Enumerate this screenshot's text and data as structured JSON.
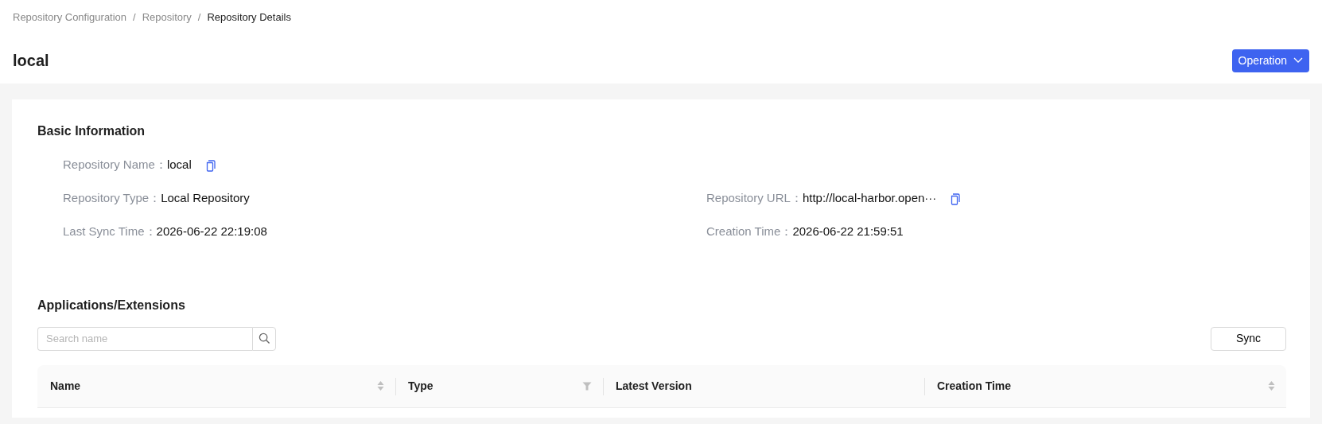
{
  "breadcrumb": [
    {
      "label": "Repository Configuration",
      "current": false
    },
    {
      "label": "Repository",
      "current": false
    },
    {
      "label": "Repository Details",
      "current": true
    }
  ],
  "breadcrumb_separator": "/",
  "page_title": "local",
  "operation_button": {
    "label": "Operation"
  },
  "basic_information": {
    "title": "Basic Information",
    "rows": [
      [
        {
          "label": "Repository Name：",
          "value": "local",
          "copyable": true
        }
      ],
      [
        {
          "label": "Repository Type：",
          "value": "Local Repository",
          "copyable": false
        },
        {
          "label": "Repository URL：",
          "value": "http://local-harbor.open···",
          "copyable": true
        }
      ],
      [
        {
          "label": "Last Sync Time：",
          "value": "2026-06-22 22:19:08",
          "copyable": false
        },
        {
          "label": "Creation Time：",
          "value": "2026-06-22 21:59:51",
          "copyable": false
        }
      ]
    ]
  },
  "applications": {
    "title": "Applications/Extensions",
    "search": {
      "placeholder": "Search name"
    },
    "sync_button": {
      "label": "Sync"
    },
    "table": {
      "columns": [
        {
          "label": "Name",
          "kind": "sort"
        },
        {
          "label": "Type",
          "kind": "filter"
        },
        {
          "label": "Latest Version",
          "kind": "plain"
        },
        {
          "label": "Creation Time",
          "kind": "sort"
        }
      ]
    }
  }
}
